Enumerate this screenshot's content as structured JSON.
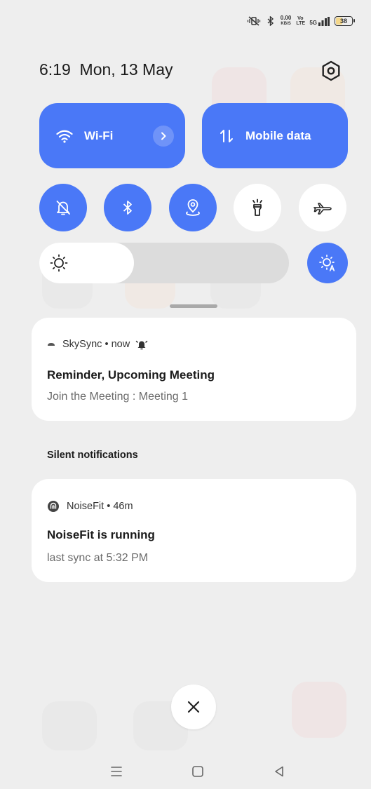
{
  "status_bar": {
    "net_speed_value": "0.00",
    "net_speed_unit": "KB/S",
    "volte": "Vo LTE",
    "network": "5G",
    "battery": "38"
  },
  "header": {
    "time": "6:19",
    "date": "Mon, 13 May"
  },
  "tiles": {
    "wifi_label": "Wi-Fi",
    "mobile_label": "Mobile data"
  },
  "toggles": [
    {
      "icon": "silent-bell-icon",
      "state": "on"
    },
    {
      "icon": "bluetooth-icon",
      "state": "on"
    },
    {
      "icon": "location-icon",
      "state": "on"
    },
    {
      "icon": "flashlight-icon",
      "state": "off"
    },
    {
      "icon": "airplane-icon",
      "state": "off"
    }
  ],
  "brightness": {
    "level": 0.38,
    "auto": true
  },
  "notifications": [
    {
      "app": "SkySync",
      "time": "now",
      "title": "Reminder, Upcoming Meeting",
      "body": "Join the Meeting : Meeting 1"
    }
  ],
  "silent_section": {
    "label": "Silent notifications",
    "items": [
      {
        "app": "NoiseFit",
        "time": "46m",
        "title": "NoiseFit is running",
        "body": "last sync at 5:32 PM"
      }
    ]
  },
  "colors": {
    "accent": "#4a78f7",
    "background": "#eeeeee",
    "card": "#ffffff"
  }
}
